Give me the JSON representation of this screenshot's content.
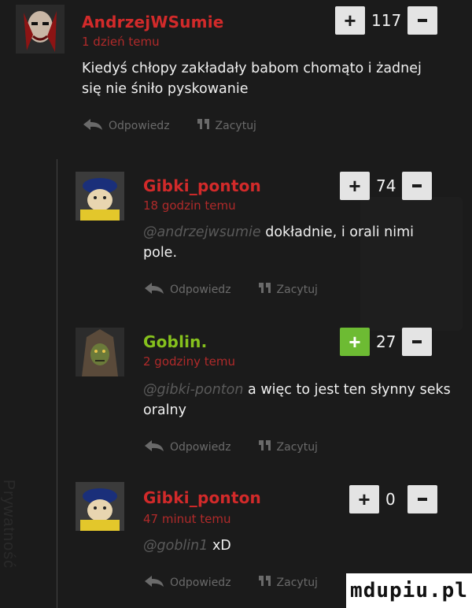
{
  "side_tab": "Prywatność",
  "watermark": "mdupiu.pl",
  "actions": {
    "reply": "Odpowiedz",
    "quote": "Zacytuj"
  },
  "comments": [
    {
      "nick": "AndrzejWSumie",
      "nick_color": "#d22a2a",
      "time": "1 dzień temu",
      "mention": "",
      "text_line1": "Kiedyś chłopy zakładały babom chomąto i żadnej",
      "text_line2": "się nie śniło pyskowanie",
      "votes": "117"
    },
    {
      "nick": "Gibki_ponton",
      "nick_color": "#d22a2a",
      "time": "18 godzin temu",
      "mention": "@andrzejwsumie",
      "text_line1": "dokładnie, i orali nimi",
      "text_line2": "pole.",
      "votes": "74"
    },
    {
      "nick": "Goblin.",
      "nick_color": "#86c11d",
      "time": "2 godziny temu",
      "mention": "@gibki-ponton",
      "text_line1": "a więc to jest ten słynny seks",
      "text_line2": "oralny",
      "votes": "27"
    },
    {
      "nick": "Gibki_ponton",
      "nick_color": "#d22a2a",
      "time": "47 minut temu",
      "mention": "@goblin1",
      "text_line1": "xD",
      "text_line2": "",
      "votes": "0"
    }
  ]
}
